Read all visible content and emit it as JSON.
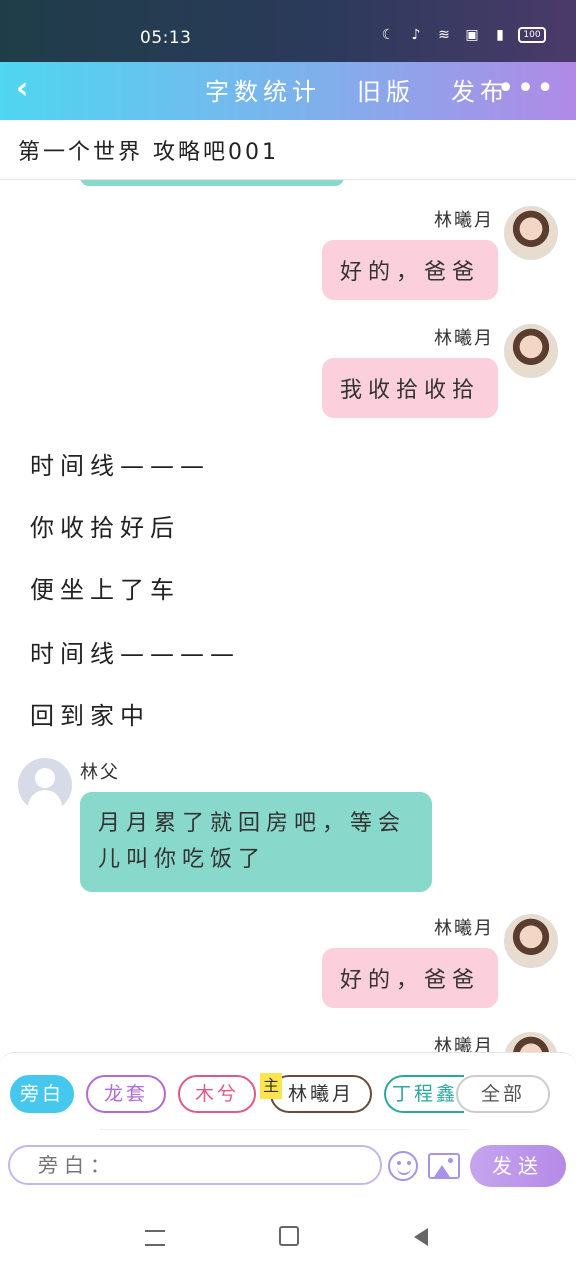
{
  "status": {
    "time": "05:13",
    "battery": "100",
    "icons": [
      "moon-icon",
      "mute-icon",
      "wifi-icon",
      "hd-icon",
      "signal-4g-icon"
    ]
  },
  "appbar": {
    "back_icon": "back-icon",
    "menu": [
      "字数统计",
      "旧版",
      "发布"
    ],
    "more_icon": "more-icon"
  },
  "title": "第一个世界 攻略吧001",
  "messages": [
    {
      "side": "right",
      "name": "林曦月",
      "text": "好的，爸爸"
    },
    {
      "side": "right",
      "name": "林曦月",
      "text": "我收拾收拾"
    },
    {
      "side": "narration",
      "text": "时间线———"
    },
    {
      "side": "narration",
      "text": "你收拾好后"
    },
    {
      "side": "narration",
      "text": "便坐上了车"
    },
    {
      "side": "narration",
      "text": "时间线————"
    },
    {
      "side": "narration",
      "text": "回到家中"
    },
    {
      "side": "left",
      "name": "林父",
      "text": "月月累了就回房吧，等会儿叫你吃饭了"
    },
    {
      "side": "right",
      "name": "林曦月",
      "text": "好的，爸爸"
    },
    {
      "side": "right",
      "name": "林曦月",
      "text": ""
    }
  ],
  "composer": {
    "chips": [
      {
        "label": "旁白",
        "active": true,
        "color": "#46c8ee"
      },
      {
        "label": "龙套",
        "active": false,
        "color": "#b36bd6"
      },
      {
        "label": "木兮",
        "active": false,
        "color": "#e05a86"
      },
      {
        "label": "林曦月",
        "active": false,
        "color": "#6a4a3a",
        "tag": "主"
      },
      {
        "label": "丁程鑫",
        "active": false,
        "color": "#2aa8a0"
      },
      {
        "label": "全部",
        "active": false,
        "color": "#cccccc"
      }
    ],
    "input_placeholder": "旁白：",
    "send_label": "发送"
  }
}
